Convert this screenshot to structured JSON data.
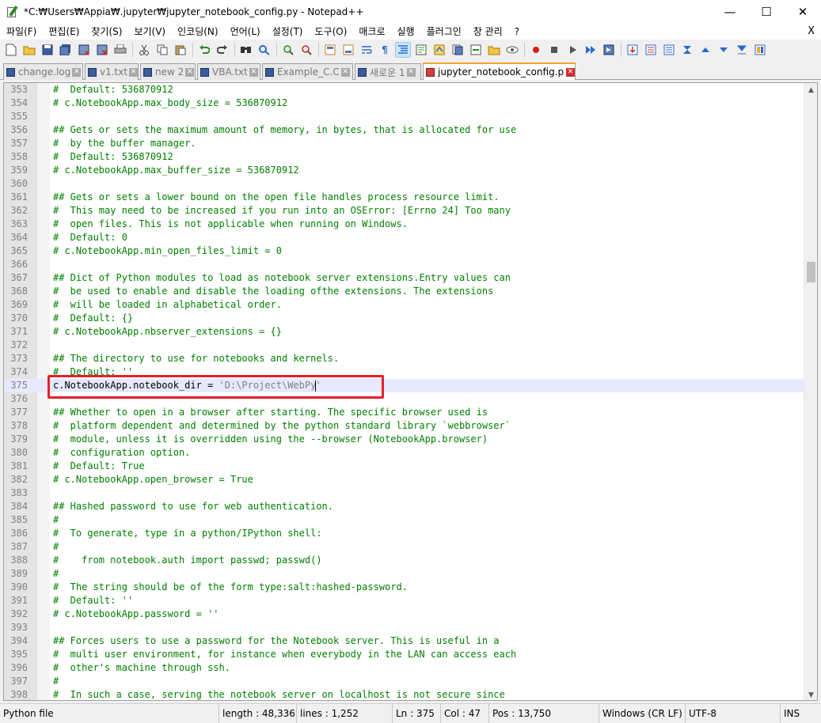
{
  "window": {
    "title": "*C:₩Users₩Appia₩.jupyter₩jupyter_notebook_config.py - Notepad++",
    "minimize": "—",
    "maximize": "☐",
    "close": "✕"
  },
  "menu": {
    "items": [
      "파일(F)",
      "편집(E)",
      "찾기(S)",
      "보기(V)",
      "인코딩(N)",
      "언어(L)",
      "설정(T)",
      "도구(O)",
      "매크로",
      "실행",
      "플러그인",
      "창 관리",
      "?"
    ],
    "close_doc": "X"
  },
  "toolbar": {
    "icons": [
      "new-file-icon",
      "open-file-icon",
      "save-icon",
      "save-all-icon",
      "close-icon",
      "close-all-icon",
      "print-icon",
      "cut-icon",
      "copy-icon",
      "paste-icon",
      "undo-icon",
      "redo-icon",
      "find-icon",
      "replace-icon",
      "zoom-in-icon",
      "zoom-out-icon",
      "sync-vertical-icon",
      "sync-horizontal-icon",
      "word-wrap-icon",
      "show-all-chars-icon",
      "indent-guide-icon",
      "doc-map-icon",
      "function-list-icon",
      "folder-workspace-icon",
      "monitoring-icon",
      "record-macro-icon",
      "stop-macro-icon",
      "play-macro-icon",
      "play-multiple-icon",
      "save-macro-icon",
      "plugin-a-icon",
      "plugin-b-icon",
      "plugin-c-icon",
      "plugin-d-icon",
      "plugin-e-icon",
      "plugin-f-icon",
      "plugin-g-icon",
      "plugin-h-icon"
    ]
  },
  "tabs": [
    {
      "label": "change.log",
      "active": false
    },
    {
      "label": "v1.txt",
      "active": false
    },
    {
      "label": "new 2",
      "active": false
    },
    {
      "label": "VBA.txt",
      "active": false
    },
    {
      "label": "Example_C.C",
      "active": false
    },
    {
      "label": "새로운 1",
      "active": false
    },
    {
      "label": "jupyter_notebook_config.py",
      "active": true
    }
  ],
  "editor": {
    "current_line": 375,
    "lines": [
      {
        "n": "353",
        "text": "#  Default: 536870912"
      },
      {
        "n": "354",
        "text": "# c.NotebookApp.max_body_size = 536870912"
      },
      {
        "n": "355",
        "text": ""
      },
      {
        "n": "356",
        "text": "## Gets or sets the maximum amount of memory, in bytes, that is allocated for use"
      },
      {
        "n": "357",
        "text": "#  by the buffer manager."
      },
      {
        "n": "358",
        "text": "#  Default: 536870912"
      },
      {
        "n": "359",
        "text": "# c.NotebookApp.max_buffer_size = 536870912"
      },
      {
        "n": "360",
        "text": ""
      },
      {
        "n": "361",
        "text": "## Gets or sets a lower bound on the open file handles process resource limit."
      },
      {
        "n": "362",
        "text": "#  This may need to be increased if you run into an OSError: [Errno 24] Too many"
      },
      {
        "n": "363",
        "text": "#  open files. This is not applicable when running on Windows."
      },
      {
        "n": "364",
        "text": "#  Default: 0"
      },
      {
        "n": "365",
        "text": "# c.NotebookApp.min_open_files_limit = 0"
      },
      {
        "n": "366",
        "text": ""
      },
      {
        "n": "367",
        "text": "## Dict of Python modules to load as notebook server extensions.Entry values can"
      },
      {
        "n": "368",
        "text": "#  be used to enable and disable the loading ofthe extensions. The extensions"
      },
      {
        "n": "369",
        "text": "#  will be loaded in alphabetical order."
      },
      {
        "n": "370",
        "text": "#  Default: {}"
      },
      {
        "n": "371",
        "text": "# c.NotebookApp.nbserver_extensions = {}"
      },
      {
        "n": "372",
        "text": ""
      },
      {
        "n": "373",
        "text": "## The directory to use for notebooks and kernels."
      },
      {
        "n": "374",
        "text": "#  Default: ''"
      },
      {
        "n": "375",
        "code": "c.NotebookApp.notebook_dir = ",
        "str_before_caret": "'D:\\Project\\WebPy",
        "str_after_caret": "'"
      },
      {
        "n": "376",
        "text": ""
      },
      {
        "n": "377",
        "text": "## Whether to open in a browser after starting. The specific browser used is"
      },
      {
        "n": "378",
        "text": "#  platform dependent and determined by the python standard library `webbrowser`"
      },
      {
        "n": "379",
        "text": "#  module, unless it is overridden using the --browser (NotebookApp.browser)"
      },
      {
        "n": "380",
        "text": "#  configuration option."
      },
      {
        "n": "381",
        "text": "#  Default: True"
      },
      {
        "n": "382",
        "text": "# c.NotebookApp.open_browser = True"
      },
      {
        "n": "383",
        "text": ""
      },
      {
        "n": "384",
        "text": "## Hashed password to use for web authentication."
      },
      {
        "n": "385",
        "text": "#"
      },
      {
        "n": "386",
        "text": "#  To generate, type in a python/IPython shell:"
      },
      {
        "n": "387",
        "text": "#"
      },
      {
        "n": "388",
        "text": "#    from notebook.auth import passwd; passwd()"
      },
      {
        "n": "389",
        "text": "#"
      },
      {
        "n": "390",
        "text": "#  The string should be of the form type:salt:hashed-password."
      },
      {
        "n": "391",
        "text": "#  Default: ''"
      },
      {
        "n": "392",
        "text": "# c.NotebookApp.password = ''"
      },
      {
        "n": "393",
        "text": ""
      },
      {
        "n": "394",
        "text": "## Forces users to use a password for the Notebook server. This is useful in a"
      },
      {
        "n": "395",
        "text": "#  multi user environment, for instance when everybody in the LAN can access each"
      },
      {
        "n": "396",
        "text": "#  other's machine through ssh."
      },
      {
        "n": "397",
        "text": "#"
      },
      {
        "n": "398",
        "text": "#  In such a case, serving the notebook server on localhost is not secure since"
      }
    ]
  },
  "scrollbar": {
    "up": "▲",
    "down": "▼",
    "position": 0.29
  },
  "status": {
    "filetype": "Python file",
    "length": "length : 48,336",
    "lines": "lines : 1,252",
    "ln": "Ln : 375",
    "col": "Col : 47",
    "pos": "Pos : 13,750",
    "eol": "Windows (CR LF)",
    "encoding": "UTF-8",
    "mode": "INS"
  },
  "colors": {
    "comment": "#008000",
    "string": "#808080",
    "highlight_box": "#e8202a",
    "current_line": "#e8e8ff",
    "active_tab_accent": "#f5a623"
  }
}
